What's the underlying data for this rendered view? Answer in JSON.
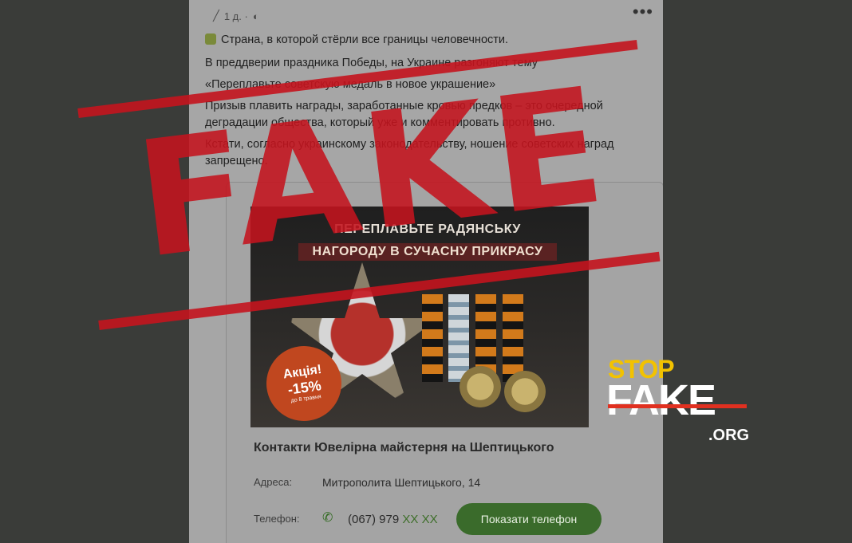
{
  "post": {
    "time": "1 д. ·",
    "menu": "•••",
    "line1": "Страна, в которой стёрли все границы человечности.",
    "line2": "В преддверии праздника Победы, на Украине разгоняют тему",
    "line3": "«Переплавьте советскую медаль в новое украшение»",
    "line4a": "Призыв плавить награды, заработанные кровью предков – это очередной",
    "line4b": "деградации общества, который уже и комментировать противно.",
    "line5a": "Кстати, согласно украинскому законодательству, ношение советских наград",
    "line5b": "запрещено."
  },
  "ad": {
    "banner1": "ПЕРЕПЛАВЬТЕ РАДЯНСЬКУ",
    "banner2": "НАГОРОДУ В СУЧАСНУ ПРИКРАСУ",
    "sale_title": "Акція!",
    "sale_percent": "-15%",
    "sale_note": "до 8 травня",
    "business_name": "Контакти Ювелірна майстерня на Шептицького",
    "address_label": "Адреса:",
    "address_value": "Митрополита Шептицького, 14",
    "phone_label": "Телефон:",
    "phone_prefix": "(067) 979",
    "phone_masked": "XX XX",
    "show_phone_button": "Показати телефон"
  },
  "stamp": {
    "text": "FAKE"
  },
  "logo": {
    "stop": "STOP",
    "fake": "FAKE",
    "org": ".ORG"
  },
  "colors": {
    "stamp": "#c4141e",
    "logo_yellow": "#f2c200",
    "button_green": "#3a6b2b"
  }
}
